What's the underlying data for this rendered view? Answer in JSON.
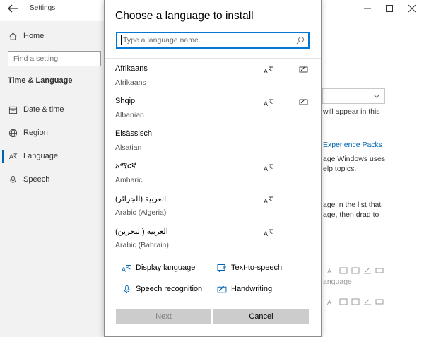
{
  "settings": {
    "title": "Settings",
    "home": "Home",
    "find_placeholder": "Find a setting",
    "section": "Time & Language",
    "nav": [
      {
        "label": "Date & time",
        "icon": "calendar-icon"
      },
      {
        "label": "Region",
        "icon": "globe-icon"
      },
      {
        "label": "Language",
        "icon": "language-icon"
      },
      {
        "label": "Speech",
        "icon": "microphone-icon"
      }
    ],
    "fragments": {
      "line1": "will appear in this",
      "line2": "Experience Packs",
      "line3": "age Windows uses",
      "line4": "elp topics.",
      "line5": "age in the list that",
      "line6": "age, then drag to",
      "line7": "anguage"
    }
  },
  "dialog": {
    "title": "Choose a language to install",
    "search_placeholder": "Type a language name...",
    "languages": [
      {
        "native": "Afrikaans",
        "english": "Afrikaans",
        "display": true,
        "handwriting": true
      },
      {
        "native": "Shqip",
        "english": "Albanian",
        "display": true,
        "handwriting": true
      },
      {
        "native": "Elsässisch",
        "english": "Alsatian",
        "display": false,
        "handwriting": false
      },
      {
        "native": "አማርኛ",
        "english": "Amharic",
        "display": true,
        "handwriting": false
      },
      {
        "native": "العربية (الجزائر)",
        "english": "Arabic (Algeria)",
        "display": true,
        "handwriting": false
      },
      {
        "native": "العربية (البحرين)",
        "english": "Arabic (Bahrain)",
        "display": true,
        "handwriting": false
      }
    ],
    "legend": {
      "display_language": "Display language",
      "text_to_speech": "Text-to-speech",
      "speech_recognition": "Speech recognition",
      "handwriting": "Handwriting"
    },
    "buttons": {
      "next": "Next",
      "cancel": "Cancel"
    }
  },
  "colors": {
    "accent": "#0078d7",
    "link": "#0063b1",
    "button_gray": "#cccccc"
  }
}
